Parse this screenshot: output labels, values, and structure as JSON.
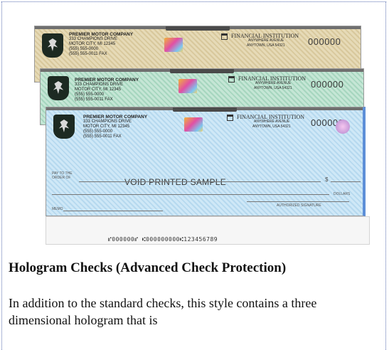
{
  "checks": [
    {
      "company": "PREMIER MOTOR COMPANY",
      "address": [
        "333 CHAMPIONS DRIVE",
        "MOTOR CITY, MI 12345",
        "(555) 555-0000",
        "(555) 555-0011 FAX"
      ],
      "bank": "FINANCIAL INSTITUTION",
      "bank_sub": [
        "ANYWHERE AVENUE",
        "ANYTOWN, USA 54321"
      ],
      "number": "000000"
    },
    {
      "company": "PREMIER MOTOR COMPANY",
      "address": [
        "333 CHAMPIONS DRIVE",
        "MOTOR CITY, MI 12345",
        "(555) 555-0000",
        "(555) 555-0011 FAX"
      ],
      "bank": "FINANCIAL INSTITUTION",
      "bank_sub": [
        "ANYWHERE AVENUE",
        "ANYTOWN, USA 54321"
      ],
      "number": "000000"
    },
    {
      "company": "PREMIER MOTOR COMPANY",
      "address": [
        "333 CHAMPIONS DRIVE",
        "MOTOR CITY, MI 12345",
        "(555) 555-0000",
        "(555) 555-0011 FAX"
      ],
      "bank": "FINANCIAL INSTITUTION",
      "bank_sub": [
        "ANYWHERE AVENUE",
        "ANYTOWN, USA 54321"
      ],
      "number": "000000"
    }
  ],
  "pay_to": [
    "PAY TO THE",
    "ORDER OF"
  ],
  "void_text": "VOID PRINTED SAMPLE",
  "dollar_sign": "$",
  "dollars": "DOLLARS",
  "memo": "MEMO",
  "signature": "AUTHORIZED SIGNATURE",
  "micr": "⑈000000⑈ ⑆000000000⑆123456789",
  "heading": "Hologram Checks (Advanced Check Protection)",
  "description": "In addition to the standard checks, this style contains a three dimensional hologram that is"
}
